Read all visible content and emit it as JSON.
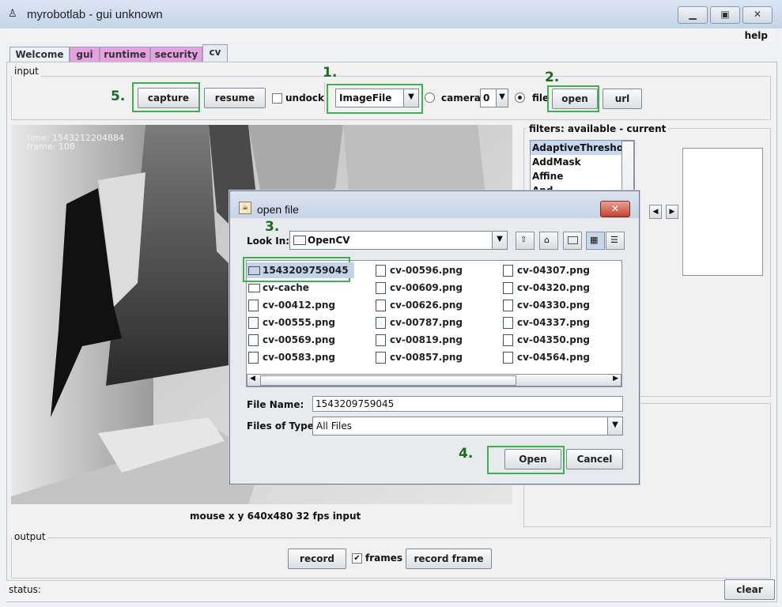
{
  "window": {
    "title": "myrobotlab - gui unknown",
    "menu_help": "help"
  },
  "tabs": [
    {
      "label": "Welcome",
      "color": "#eef0f3"
    },
    {
      "label": "gui",
      "color": "#e7a1e3"
    },
    {
      "label": "runtime",
      "color": "#e7a1e3"
    },
    {
      "label": "security",
      "color": "#e7a1e3"
    },
    {
      "label": "cv",
      "color": "#e6ebf1"
    }
  ],
  "input": {
    "group_label": "input",
    "capture": "capture",
    "resume": "resume",
    "undock": "undock",
    "source": "ImageFile",
    "camera_label": "camera",
    "camera_index": "0",
    "file_label": "file",
    "open": "open",
    "url": "url"
  },
  "video": {
    "time": "time:   1543212204884",
    "frame": "frame:   108",
    "status_line": "mouse x y  640x480  32 fps  input"
  },
  "filters": {
    "label": "filters: available - current",
    "available": [
      "AdaptiveThreshold",
      "AddMask",
      "Affine",
      "And"
    ]
  },
  "dialog": {
    "title": "open file",
    "look_in_label": "Look In:",
    "look_in_value": "OpenCV",
    "files": [
      {
        "name": "1543209759045",
        "type": "folder"
      },
      {
        "name": "cv-cache",
        "type": "folder"
      },
      {
        "name": "cv-00412.png",
        "type": "file"
      },
      {
        "name": "cv-00555.png",
        "type": "file"
      },
      {
        "name": "cv-00569.png",
        "type": "file"
      },
      {
        "name": "cv-00583.png",
        "type": "file"
      },
      {
        "name": "cv-00596.png",
        "type": "file"
      },
      {
        "name": "cv-00609.png",
        "type": "file"
      },
      {
        "name": "cv-00626.png",
        "type": "file"
      },
      {
        "name": "cv-00787.png",
        "type": "file"
      },
      {
        "name": "cv-00819.png",
        "type": "file"
      },
      {
        "name": "cv-00857.png",
        "type": "file"
      },
      {
        "name": "cv-04307.png",
        "type": "file"
      },
      {
        "name": "cv-04320.png",
        "type": "file"
      },
      {
        "name": "cv-04330.png",
        "type": "file"
      },
      {
        "name": "cv-04337.png",
        "type": "file"
      },
      {
        "name": "cv-04350.png",
        "type": "file"
      },
      {
        "name": "cv-04564.png",
        "type": "file"
      }
    ],
    "file_name_label": "File Name:",
    "file_name_value": "1543209759045",
    "files_of_type_label": "Files of Type:",
    "files_of_type_value": "All Files",
    "open_button": "Open",
    "cancel_button": "Cancel"
  },
  "annotations": {
    "step1": "1.",
    "step2": "2.",
    "step3": "3.",
    "step4": "4.",
    "step5": "5."
  },
  "output": {
    "group_label": "output",
    "record": "record",
    "frames": "frames",
    "record_frame": "record frame"
  },
  "status": {
    "label": "status:",
    "clear": "clear"
  },
  "colors": {
    "highlight_green": "#3cb34a",
    "step_text": "#1c6b22",
    "pink_tab": "#e7a1e3"
  }
}
